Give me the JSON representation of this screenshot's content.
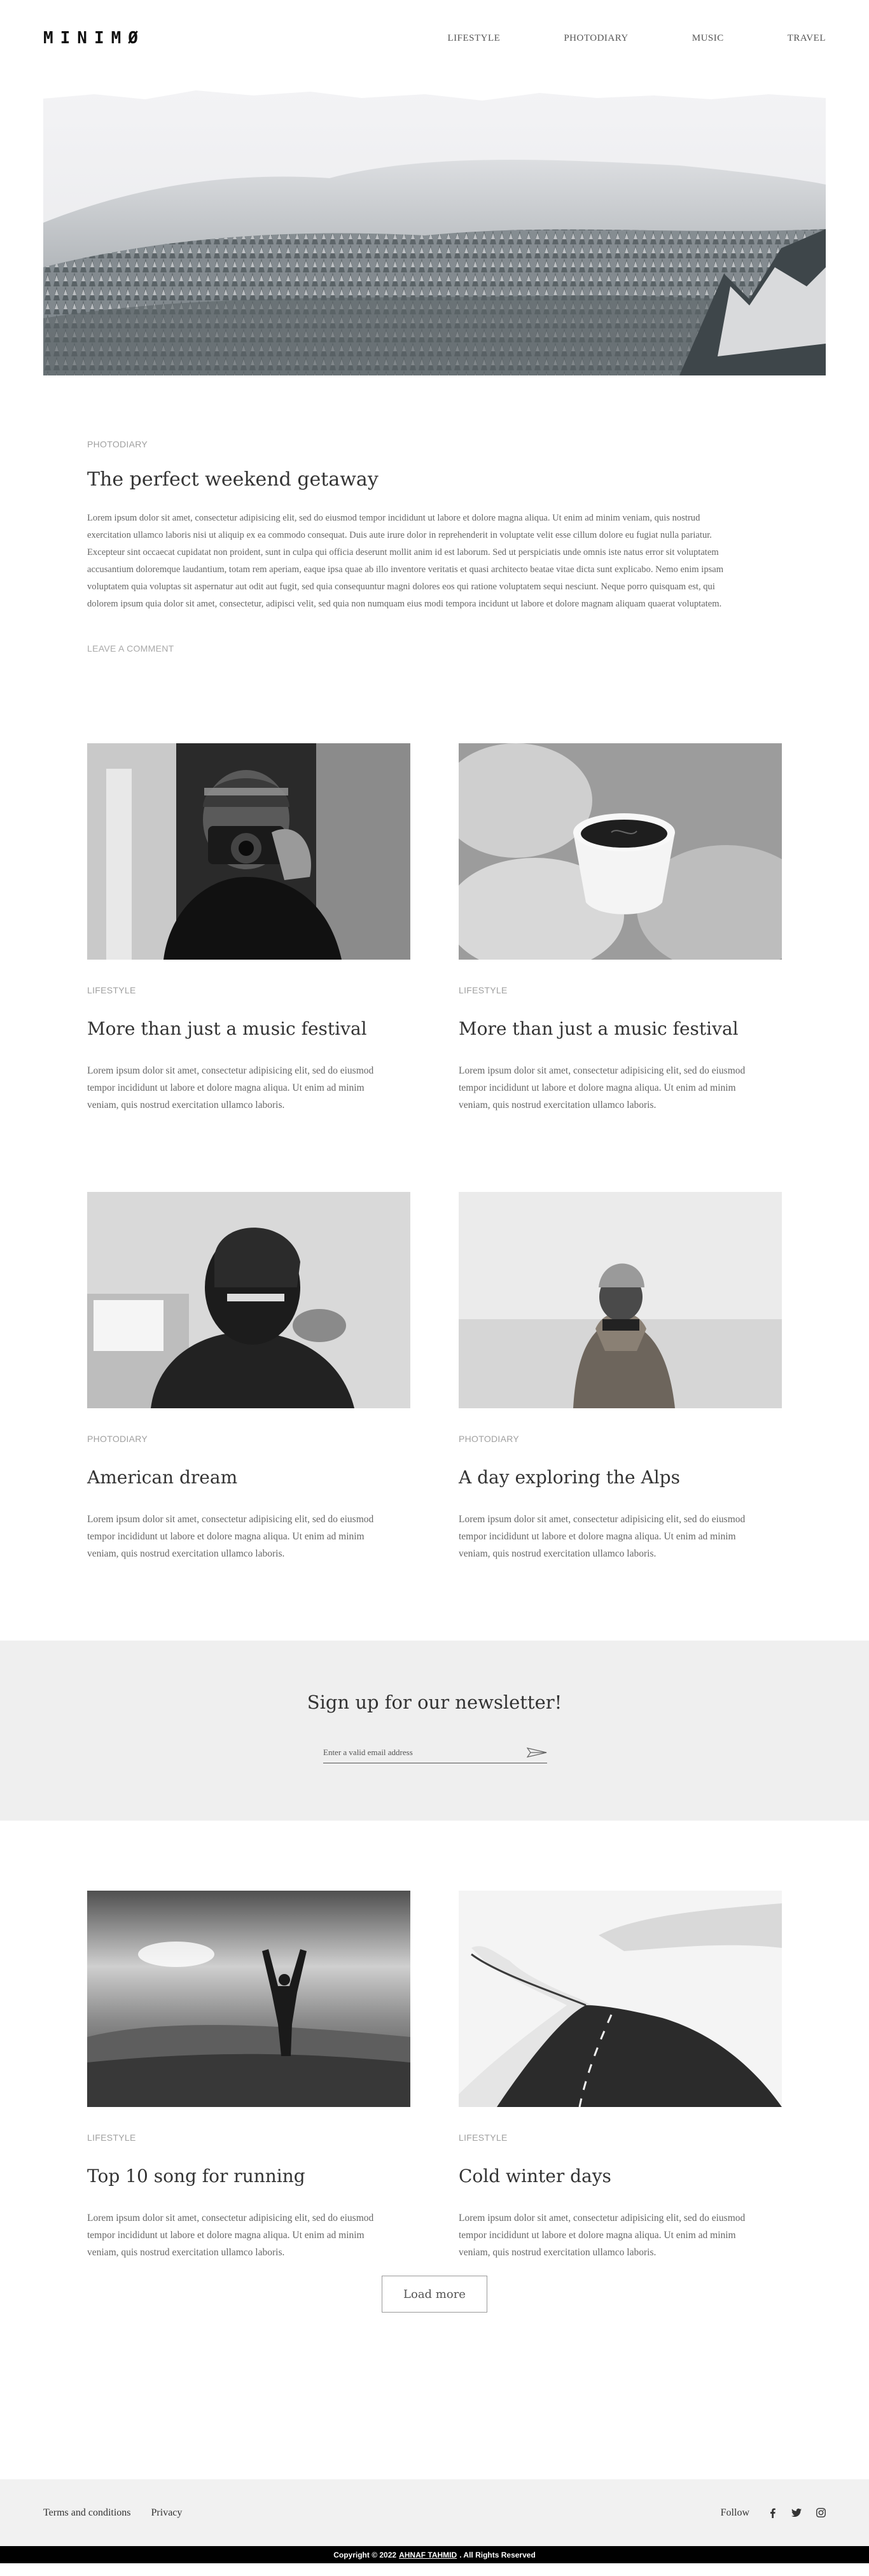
{
  "header": {
    "logo": "MINIMØ",
    "nav": [
      "LIFESTYLE",
      "PHOTODIARY",
      "MUSIC",
      "TRAVEL"
    ]
  },
  "featured": {
    "category": "PHOTODIARY",
    "title": "The perfect weekend getaway",
    "text": "Lorem ipsum dolor sit amet, consectetur adipisicing elit, sed do eiusmod tempor incididunt ut labore et dolore magna aliqua. Ut enim ad minim veniam, quis nostrud exercitation ullamco laboris nisi ut aliquip ex ea commodo consequat. Duis aute irure dolor in reprehenderit in voluptate velit esse cillum dolore eu fugiat nulla pariatur. Excepteur sint occaecat cupidatat non proident, sunt in culpa qui officia deserunt mollit anim id est laborum. Sed ut perspiciatis unde omnis iste natus error sit voluptatem accusantium doloremque laudantium, totam rem aperiam, eaque ipsa quae ab illo inventore veritatis et quasi architecto beatae vitae dicta sunt explicabo. Nemo enim ipsam voluptatem quia voluptas sit aspernatur aut odit aut fugit, sed quia consequuntur magni dolores eos qui ratione voluptatem sequi nesciunt. Neque porro quisquam est, qui dolorem ipsum quia dolor sit amet, consectetur, adipisci velit, sed quia non numquam eius modi tempora incidunt ut labore et dolore magnam aliquam quaerat voluptatem.",
    "comment_link": "LEAVE A COMMENT"
  },
  "posts": [
    {
      "category": "LIFESTYLE",
      "title": "More than just a music festival",
      "excerpt": "Lorem ipsum dolor sit amet, consectetur adipisicing elit, sed do eiusmod tempor incididunt ut labore et dolore magna aliqua. Ut enim ad minim veniam, quis nostrud exercitation ullamco laboris."
    },
    {
      "category": "LIFESTYLE",
      "title": "More than just a music festival",
      "excerpt": "Lorem ipsum dolor sit amet, consectetur adipisicing elit, sed do eiusmod tempor incididunt ut labore et dolore magna aliqua. Ut enim ad minim veniam, quis nostrud exercitation ullamco laboris."
    },
    {
      "category": "PHOTODIARY",
      "title": "American dream",
      "excerpt": "Lorem ipsum dolor sit amet, consectetur adipisicing elit, sed do eiusmod tempor incididunt ut labore et dolore magna aliqua. Ut enim ad minim veniam, quis nostrud exercitation ullamco laboris."
    },
    {
      "category": "PHOTODIARY",
      "title": "A day exploring the Alps",
      "excerpt": "Lorem ipsum dolor sit amet, consectetur adipisicing elit, sed do eiusmod tempor incididunt ut labore et dolore magna aliqua. Ut enim ad minim veniam, quis nostrud exercitation ullamco laboris."
    },
    {
      "category": "LIFESTYLE",
      "title": "Top 10 song for running",
      "excerpt": "Lorem ipsum dolor sit amet, consectetur adipisicing elit, sed do eiusmod tempor incididunt ut labore et dolore magna aliqua. Ut enim ad minim veniam, quis nostrud exercitation ullamco laboris."
    },
    {
      "category": "LIFESTYLE",
      "title": "Cold winter days",
      "excerpt": "Lorem ipsum dolor sit amet, consectetur adipisicing elit, sed do eiusmod tempor incididunt ut labore et dolore magna aliqua. Ut enim ad minim veniam, quis nostrud exercitation ullamco laboris."
    }
  ],
  "newsletter": {
    "title": "Sign up for our newsletter!",
    "placeholder": "Enter a valid email address"
  },
  "load_more": "Load more",
  "footer": {
    "links": [
      "Terms and conditions",
      "Privacy"
    ],
    "follow": "Follow",
    "social_icons": [
      "facebook-icon",
      "twitter-icon",
      "instagram-icon"
    ]
  },
  "copyright": {
    "prefix": "Copyright © 2022",
    "author": "AHNAF TAHMID",
    "suffix": ". All Rights Reserved"
  }
}
